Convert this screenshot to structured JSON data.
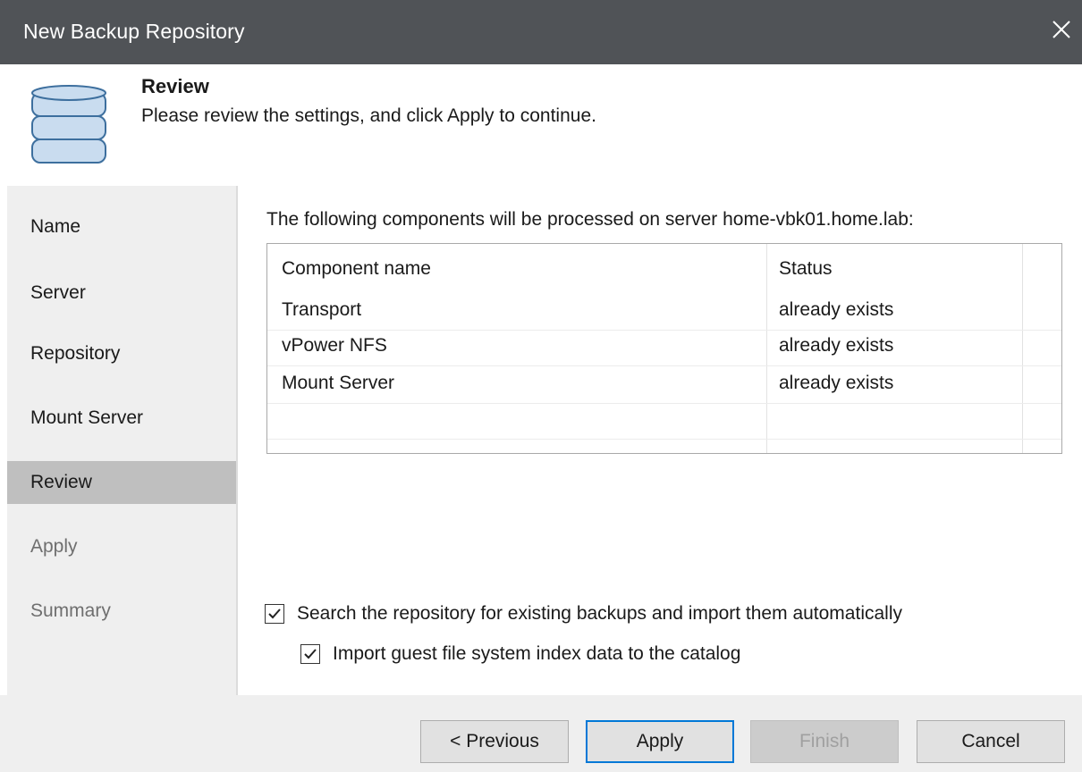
{
  "window": {
    "title": "New Backup Repository",
    "close_icon": "close-icon"
  },
  "header": {
    "icon": "database-icon",
    "step_title": "Review",
    "step_description": "Please review the settings, and click Apply to continue."
  },
  "nav": {
    "items": [
      {
        "label": "Name",
        "state": "normal"
      },
      {
        "label": "Server",
        "state": "normal"
      },
      {
        "label": "Repository",
        "state": "normal"
      },
      {
        "label": "Mount Server",
        "state": "normal"
      },
      {
        "label": "Review",
        "state": "active"
      },
      {
        "label": "Apply",
        "state": "disabled"
      },
      {
        "label": "Summary",
        "state": "disabled"
      }
    ]
  },
  "main": {
    "intro": "The following components will be processed on server home-vbk01.home.lab:",
    "table": {
      "columns": [
        "Component name",
        "Status"
      ],
      "rows": [
        [
          "Transport",
          "already exists"
        ],
        [
          "vPower NFS",
          "already exists"
        ],
        [
          "Mount Server",
          "already exists"
        ]
      ]
    },
    "options": [
      {
        "label": "Search the repository for existing backups and import them automatically",
        "checked": true
      },
      {
        "label": "Import guest file system index data to the catalog",
        "checked": true
      }
    ]
  },
  "footer": {
    "previous_label": "< Previous",
    "apply_label": "Apply",
    "finish_label": "Finish",
    "cancel_label": "Cancel"
  },
  "colors": {
    "titlebar": "#505357",
    "accent_border": "#0078d7",
    "nav_active": "#bfbfbf",
    "db_icon_fill": "#c9dcef",
    "db_icon_stroke": "#3d6f9e"
  }
}
